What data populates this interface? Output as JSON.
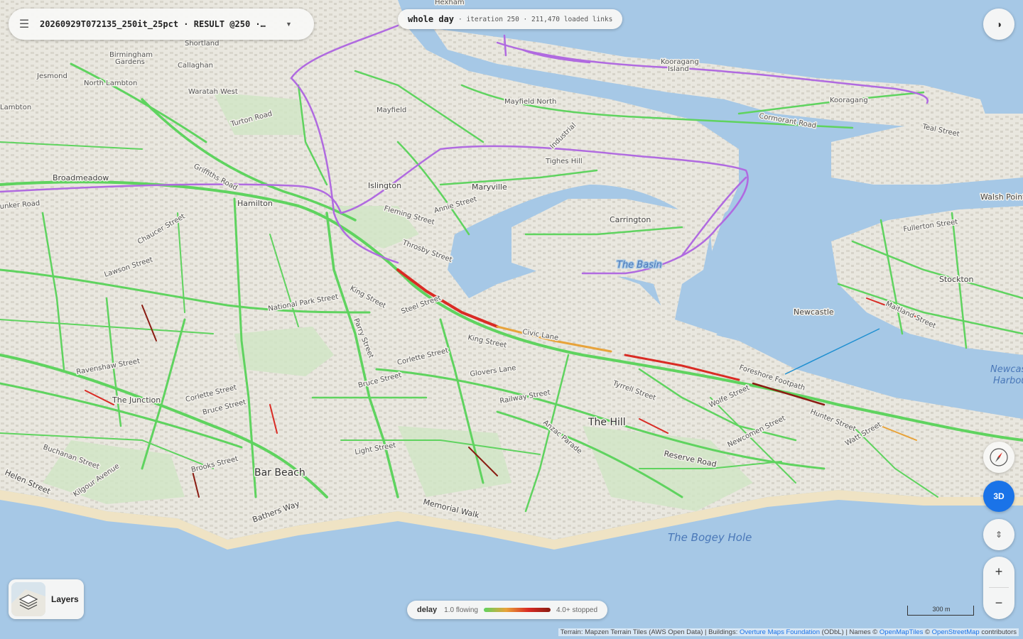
{
  "run_selector": {
    "menu_icon": "hamburger-menu-icon",
    "title": "20260929T072135_250it_25pct · RESULT @250 ·…",
    "caret_icon": "caret-down-icon"
  },
  "status": {
    "period": "whole day",
    "detail": "· iteration 250 · 211,470 loaded links"
  },
  "controls": {
    "theme_icon": "contrast-icon",
    "compass_icon": "compass-icon",
    "mode_3d_label": "3D",
    "pitch_icon": "pitch-arrows-icon",
    "zoom_in_label": "+",
    "zoom_out_label": "−"
  },
  "layers": {
    "label": "Layers",
    "icon": "layers-icon"
  },
  "legend": {
    "title": "delay",
    "min_label": "1.0 flowing",
    "max_label": "4.0+ stopped",
    "colors": [
      "#5fd35f",
      "#e8a33a",
      "#d92b24",
      "#8a1c12"
    ]
  },
  "scale": {
    "label": "300 m"
  },
  "attribution": {
    "terrain": "Terrain: Mapzen Terrain Tiles (AWS Open Data) | Buildings: ",
    "overture_link": "Overture Maps Foundation",
    "odbl": " (ODbL) | Names © ",
    "openmaptiles_link": "OpenMapTiles",
    "sep": " © ",
    "osm_link": "OpenStreetMap",
    "contributors": " contributors"
  },
  "map": {
    "colors": {
      "water": "#a6c8e6",
      "land": "#ecebe4",
      "park": "#cfe6c4",
      "flowing": "#5fd35f",
      "delayed": "#e8a33a",
      "congested": "#d92b24",
      "stopped": "#8a1c12",
      "rail": "#b06ae0"
    },
    "labels": {
      "hexham": "Hexham",
      "shortland": "Shortland",
      "birmingham_gardens": "Birmingham\nGardens",
      "callaghan": "Callaghan",
      "jesmond": "Jesmond",
      "north_lambton": "North Lambton",
      "waratah_west": "Waratah West",
      "lambton": "Lambton",
      "mayfield": "Mayfield",
      "mayfield_north": "Mayfield North",
      "kooragang_island": "Kooragang\nIsland",
      "kooragang": "Kooragang",
      "cormorant_road": "Cormorant Road",
      "teal_street": "Teal Street",
      "turton_road": "Turton Road",
      "griffiths_road": "Griffiths Road",
      "broadmeadow": "Broadmeadow",
      "bunker_road": "unker Road",
      "hamilton": "Hamilton",
      "islington": "Islington",
      "maryville": "Maryville",
      "tighes_hill": "Tighes Hill",
      "industrial": "Industrial",
      "carrington": "Carrington",
      "the_basin": "The Basin",
      "walsh_point": "Walsh Point",
      "fullerton_street": "Fullerton Street",
      "stockton": "Stockton",
      "newcastle": "Newcastle",
      "maitland_street": "Maitland Street",
      "newcastle_harbour": "Newcas\nHarbou",
      "king_street": "King Street",
      "king_street_2": "King Street",
      "steel_street": "Steel Street",
      "national_park_street": "National Park Street",
      "parry_street": "Parry Street",
      "civic_lane": "Civic Lane",
      "foreshore_footpath": "Foreshore Footpath",
      "ravenshaw_street": "Ravenshaw Street",
      "the_junction": "The Junction",
      "corlette_street": "Corlette Street",
      "corlette_street_2": "Corlette Street",
      "bruce_street": "Bruce Street",
      "bruce_street_2": "Bruce Street",
      "glovers_lane": "Glovers Lane",
      "railway_street": "Railway Street",
      "tyrrell_street": "Tyrrell Street",
      "wolfe_street": "Wolfe Street",
      "hunter_street": "Hunter Street",
      "watt_street": "Watt Street",
      "newcomen_street": "Newcomen Street",
      "the_hill": "The Hill",
      "anzac_parade": "Anzac Parade",
      "reserve_road": "Reserve Road",
      "buchanan_street": "Buchanan Street",
      "brooks_street": "Brooks Street",
      "bar_beach": "Bar Beach",
      "light_street": "Light Street",
      "helen_street": "Helen Street",
      "kilgour_avenue": "Kilgour Avenue",
      "bathers_way": "Bathers Way",
      "memorial_walk": "Memorial Walk",
      "bogey_hole": "The Bogey Hole",
      "lawson_street": "Lawson Street",
      "fleming_street": "Fleming Street",
      "annie_street": "Annie Street",
      "throsby_street": "Throsby Street",
      "chaucer_street": "Chaucer Street"
    }
  }
}
